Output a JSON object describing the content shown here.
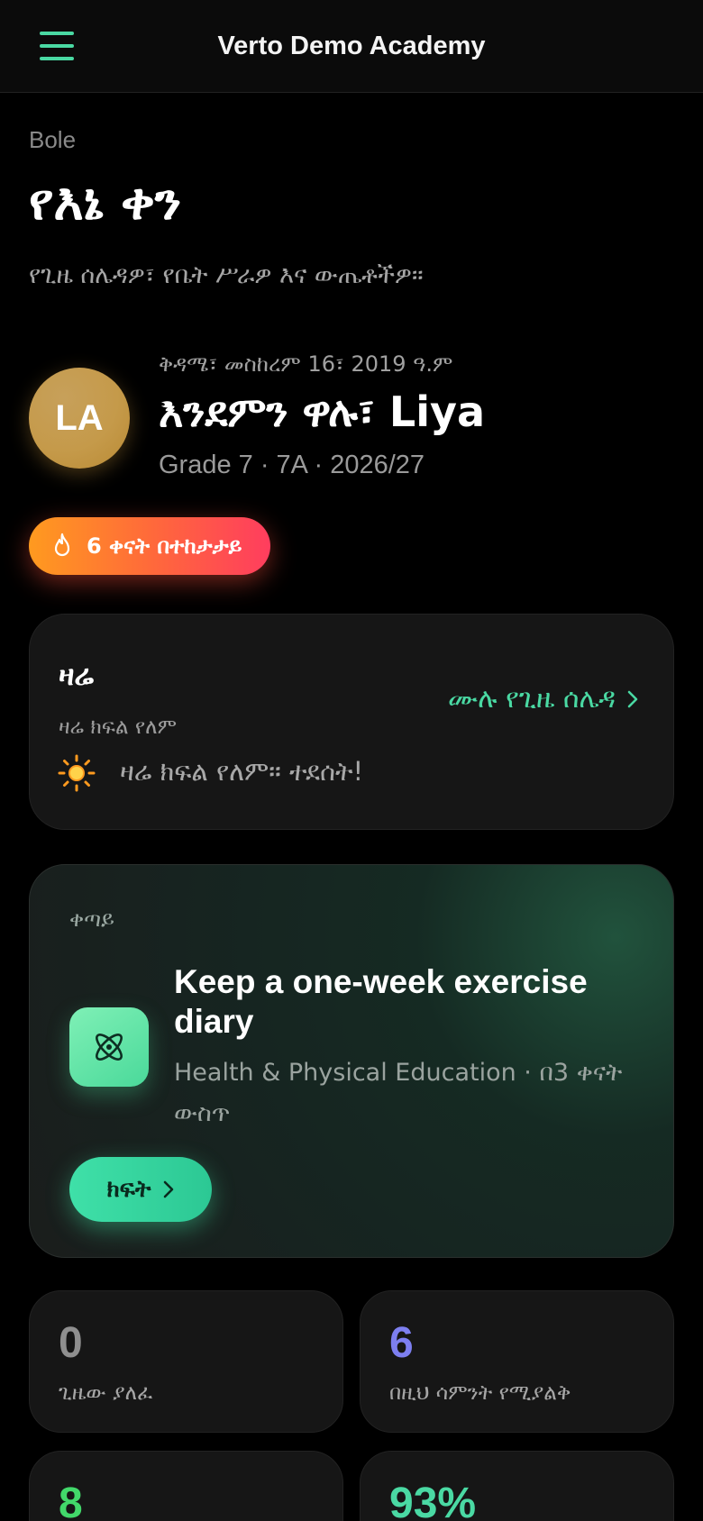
{
  "app": {
    "title": "Verto Demo Academy"
  },
  "header": {
    "location": "Bole",
    "title": "የእኔ ቀን",
    "subtitle": "የጊዜ ሰሌዳዎ፣ የቤት ሥራዎ እና ውጤቶችዎ።"
  },
  "profile": {
    "initials": "LA",
    "date": "ቅዳሜ፣ መስከረም 16፣ 2019 ዓ.ም",
    "greeting": "እንደምን ዋሉ፣ Liya",
    "class_info": "Grade 7 · 7A · 2026/27"
  },
  "streak": {
    "label": "6 ቀናት በተከታታይ",
    "icon": "flame-icon"
  },
  "today": {
    "title": "ዛሬ",
    "subtitle": "ዛሬ ክፍል የለም",
    "message": "ዛሬ ክፍል የለም። ተደሰት!",
    "schedule_link": "ሙሉ የጊዜ ሰሌዳ",
    "icon": "sun-icon"
  },
  "next": {
    "label": "ቀጣይ",
    "title": "Keep a one-week exercise diary",
    "meta": "Health & Physical Education · በ3 ቀናት ውስጥ",
    "open_label": "ክፍት",
    "icon": "atom-icon"
  },
  "stats": [
    {
      "value": "0",
      "label": "ጊዜው ያለፈ",
      "color": "#8f8f8f"
    },
    {
      "value": "6",
      "label": "በዚህ ሳምንት የሚያልቅ",
      "color": "#7d7ff0"
    },
    {
      "value": "8",
      "label": "",
      "color": "#42d86a"
    },
    {
      "value": "93%",
      "label": "",
      "color": "#4ad9a3"
    }
  ],
  "colors": {
    "accent": "#4ad9a3",
    "streak_start": "#ff9a1f",
    "streak_end": "#ff3d5e"
  }
}
